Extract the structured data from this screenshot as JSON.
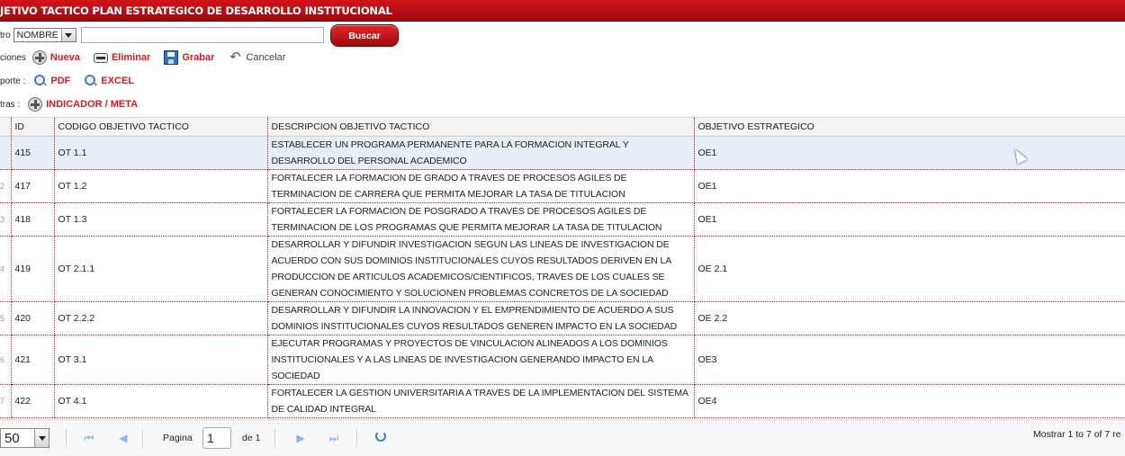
{
  "title": "JETIVO TACTICO PLAN ESTRATEGICO DE DESARROLLO INSTITUCIONAL",
  "filter": {
    "label": "tro",
    "field_value": "NOMBRE",
    "search_value": "",
    "search_button": "Buscar"
  },
  "actions": {
    "label": "ciones",
    "new": "Nueva",
    "delete": "Eliminar",
    "save": "Grabar",
    "cancel": "Cancelar"
  },
  "report": {
    "label": "porte :",
    "pdf": "PDF",
    "excel": "EXCEL"
  },
  "others": {
    "label": "tras :",
    "indicator": "INDICADOR / META"
  },
  "table": {
    "columns": [
      "ID",
      "CODIGO OBJETIVO TACTICO",
      "DESCRIPCION OBJETIVO TACTICO",
      "OBJETIVO ESTRATEGICO"
    ],
    "rows": [
      {
        "rn": "",
        "id": "415",
        "code": "OT 1.1",
        "desc": "ESTABLECER UN PROGRAMA PERMANENTE PARA LA FORMACION INTEGRAL Y DESARROLLO DEL PERSONAL ACADEMICO",
        "oe": "OE1"
      },
      {
        "rn": "2",
        "id": "417",
        "code": "OT 1.2",
        "desc": "FORTALECER LA FORMACION DE GRADO A TRAVES DE PROCESOS AGILES DE TERMINACION DE CARRERA QUE PERMITA MEJORAR LA TASA DE TITULACION",
        "oe": "OE1"
      },
      {
        "rn": "3",
        "id": "418",
        "code": "OT 1.3",
        "desc": "FORTALECER LA FORMACION DE POSGRADO A TRAVES DE PROCESOS AGILES DE TERMINACION DE LOS PROGRAMAS QUE PERMITA MEJORAR LA TASA DE TITULACION",
        "oe": "OE1"
      },
      {
        "rn": "4",
        "id": "419",
        "code": "OT 2.1.1",
        "desc": "DESARROLLAR Y DIFUNDIR INVESTIGACION SEGUN LAS LINEAS DE INVESTIGACION DE ACUERDO CON SUS DOMINIOS INSTITUCIONALES CUYOS RESULTADOS DERIVEN EN LA PRODUCCION DE ARTICULOS ACADEMICOS/CIENTIFICOS, TRAVES DE LOS CUALES SE GENERAN CONOCIMIENTO Y SOLUCIONEN PROBLEMAS CONCRETOS DE LA SOCIEDAD",
        "oe": "OE 2.1"
      },
      {
        "rn": "5",
        "id": "420",
        "code": "OT 2.2.2",
        "desc": "DESARROLLAR Y DIFUNDIR LA INNOVACION Y EL EMPRENDIMIENTO DE ACUERDO A SUS DOMINIOS INSTITUCIONALES CUYOS RESULTADOS GENEREN IMPACTO EN LA SOCIEDAD",
        "oe": "OE 2.2"
      },
      {
        "rn": "6",
        "id": "421",
        "code": "OT 3.1",
        "desc": "EJECUTAR PROGRAMAS Y PROYECTOS DE VINCULACION ALINEADOS A LOS DOMINIOS INSTITUCIONALES Y A LAS LINEAS DE INVESTIGACION GENERANDO IMPACTO EN LA SOCIEDAD",
        "oe": "OE3"
      },
      {
        "rn": "7",
        "id": "422",
        "code": "OT 4.1",
        "desc": "FORTALECER LA GESTION UNIVERSITARIA A TRAVES DE LA IMPLEMENTACION DEL SISTEMA DE CALIDAD INTEGRAL",
        "oe": "OE4"
      }
    ]
  },
  "pager": {
    "page_size": "50",
    "page_label": "Pagina",
    "page": "1",
    "of_label": "de 1",
    "summary": "Mostrar 1 to 7 of 7 re"
  },
  "colors": {
    "brand": "#b30f14",
    "selected_row": "#e8eef8"
  }
}
